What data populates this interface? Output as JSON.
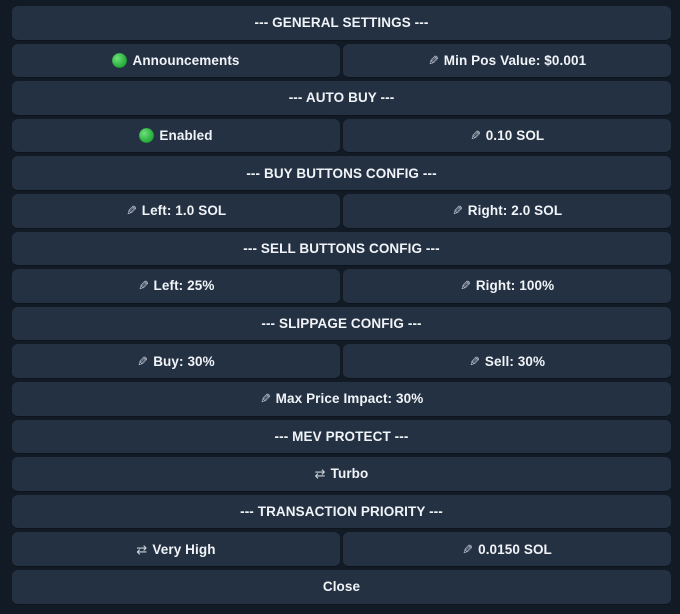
{
  "menu": {
    "rows": [
      [
        {
          "label": "--- GENERAL SETTINGS ---",
          "icon": ""
        }
      ],
      [
        {
          "label": "Announcements",
          "icon": "green-circle-icon"
        },
        {
          "label": "Min Pos Value: $0.001",
          "icon": "pencil-icon"
        }
      ],
      [
        {
          "label": "--- AUTO BUY ---",
          "icon": ""
        }
      ],
      [
        {
          "label": "Enabled",
          "icon": "green-circle-icon"
        },
        {
          "label": "0.10 SOL",
          "icon": "pencil-icon"
        }
      ],
      [
        {
          "label": "--- BUY BUTTONS CONFIG ---",
          "icon": ""
        }
      ],
      [
        {
          "label": "Left: 1.0 SOL",
          "icon": "pencil-icon"
        },
        {
          "label": "Right: 2.0 SOL",
          "icon": "pencil-icon"
        }
      ],
      [
        {
          "label": "--- SELL BUTTONS CONFIG ---",
          "icon": ""
        }
      ],
      [
        {
          "label": "Left: 25%",
          "icon": "pencil-icon"
        },
        {
          "label": "Right: 100%",
          "icon": "pencil-icon"
        }
      ],
      [
        {
          "label": "--- SLIPPAGE CONFIG ---",
          "icon": ""
        }
      ],
      [
        {
          "label": "Buy: 30%",
          "icon": "pencil-icon"
        },
        {
          "label": "Sell: 30%",
          "icon": "pencil-icon"
        }
      ],
      [
        {
          "label": "Max Price Impact: 30%",
          "icon": "pencil-icon"
        }
      ],
      [
        {
          "label": "--- MEV PROTECT ---",
          "icon": ""
        }
      ],
      [
        {
          "label": "Turbo",
          "icon": "swap-arrows-icon"
        }
      ],
      [
        {
          "label": "--- TRANSACTION PRIORITY ---",
          "icon": ""
        }
      ],
      [
        {
          "label": "Very High",
          "icon": "swap-arrows-icon"
        },
        {
          "label": "0.0150 SOL",
          "icon": "pencil-icon"
        }
      ],
      [
        {
          "label": "Close",
          "icon": ""
        }
      ]
    ]
  },
  "colors": {
    "background": "#121b25",
    "button": "#243142",
    "text": "#f0f3f7",
    "status_green": "#2fb545"
  }
}
